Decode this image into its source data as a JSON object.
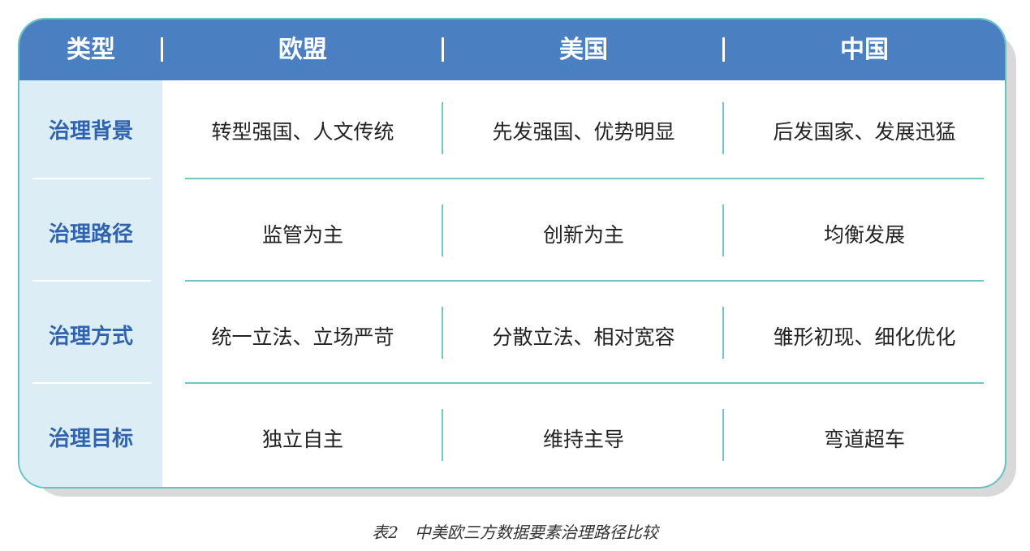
{
  "table": {
    "headers": [
      "类型",
      "欧盟",
      "美国",
      "中国"
    ],
    "rows": [
      {
        "label": "治理背景",
        "cells": [
          "转型强国、人文传统",
          "先发强国、优势明显",
          "后发国家、发展迅猛"
        ]
      },
      {
        "label": "治理路径",
        "cells": [
          "监管为主",
          "创新为主",
          "均衡发展"
        ]
      },
      {
        "label": "治理方式",
        "cells": [
          "统一立法、立场严苛",
          "分散立法、相对宽容",
          "雏形初现、细化优化"
        ]
      },
      {
        "label": "治理目标",
        "cells": [
          "独立自主",
          "维持主导",
          "弯道超车"
        ]
      }
    ]
  },
  "caption": "表2　中美欧三方数据要素治理路径比较",
  "colors": {
    "header": "#4a7fc1",
    "label_column": "#dcedf6",
    "label_text": "#2f63b0",
    "divider": "#72c4c8"
  }
}
